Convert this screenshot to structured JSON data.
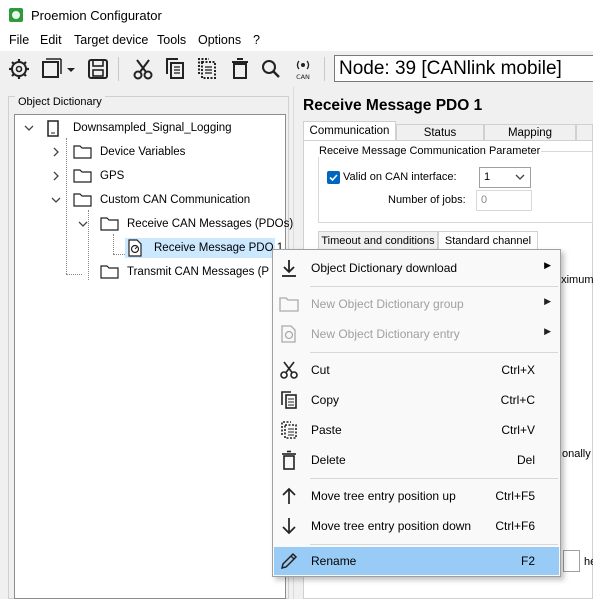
{
  "window": {
    "title": "Proemion Configurator",
    "app_icon": "proemion-app-icon"
  },
  "menubar": [
    "File",
    "Edit",
    "Target device",
    "Tools",
    "Options",
    "?"
  ],
  "toolbar": {
    "icons": [
      "settings-icon",
      "window-icon",
      "dropdown-arrow-icon",
      "save-icon",
      "cut-icon",
      "copy-icon",
      "paste-icon",
      "delete-icon",
      "search-icon",
      "can-icon"
    ],
    "can_label": "CAN",
    "node_label": "Node: 39 [CANlink mobile]"
  },
  "object_dictionary": {
    "legend": "Object Dictionary",
    "tree": [
      {
        "label": "Downsampled_Signal_Logging",
        "level": 0,
        "expanded": true
      },
      {
        "label": "Device Variables",
        "level": 1,
        "expanded": false
      },
      {
        "label": "GPS",
        "level": 1,
        "expanded": false
      },
      {
        "label": "Custom CAN Communication",
        "level": 1,
        "expanded": true
      },
      {
        "label": "Receive CAN Messages (PDOs)",
        "level": 2,
        "expanded": true
      },
      {
        "label": "Receive Message PDO 1",
        "level": 3,
        "selected": true
      },
      {
        "label": "Transmit CAN Messages (PDOs)",
        "level": 2
      }
    ]
  },
  "detail": {
    "title": "Receive Message PDO 1",
    "tabs": [
      "Communication",
      "Status",
      "Mapping"
    ],
    "active_tab": "Communication",
    "rx_group": {
      "legend": "Receive Message Communication Parameter",
      "valid_label": "Valid on CAN interface:",
      "valid_checked": true,
      "can_interface": "1",
      "jobs_label": "Number of jobs:",
      "jobs_value": "0"
    },
    "subtabs": [
      "Timeout and conditions",
      "Standard channel"
    ],
    "active_subtab": "Standard channel",
    "clipped_text": {
      "maximum": "aximum",
      "onally": "onally",
      "he": "he"
    }
  },
  "context_menu": {
    "items": [
      {
        "label": "Object Dictionary download",
        "icon": "download-icon",
        "submenu": true,
        "enabled": true
      },
      {
        "label": "New Object Dictionary group",
        "icon": "folder-icon",
        "submenu": true,
        "enabled": false
      },
      {
        "label": "New Object Dictionary entry",
        "icon": "entry-icon",
        "submenu": true,
        "enabled": false
      },
      {
        "label": "Cut",
        "icon": "cut-icon",
        "shortcut": "Ctrl+X",
        "enabled": true
      },
      {
        "label": "Copy",
        "icon": "copy-icon",
        "shortcut": "Ctrl+C",
        "enabled": true
      },
      {
        "label": "Paste",
        "icon": "paste-icon",
        "shortcut": "Ctrl+V",
        "enabled": true
      },
      {
        "label": "Delete",
        "icon": "delete-icon",
        "shortcut": "Del",
        "enabled": true
      },
      {
        "label": "Move tree entry position up",
        "icon": "arrow-up-icon",
        "shortcut": "Ctrl+F5",
        "enabled": true
      },
      {
        "label": "Move tree entry position down",
        "icon": "arrow-down-icon",
        "shortcut": "Ctrl+F6",
        "enabled": true
      },
      {
        "label": "Rename",
        "icon": "rename-icon",
        "shortcut": "F2",
        "enabled": true,
        "hovered": true
      }
    ]
  },
  "colors": {
    "selection": "#cce8ff",
    "hover": "#99cbf7",
    "accent": "#0067c0",
    "app_icon": "#2e9a3a"
  }
}
